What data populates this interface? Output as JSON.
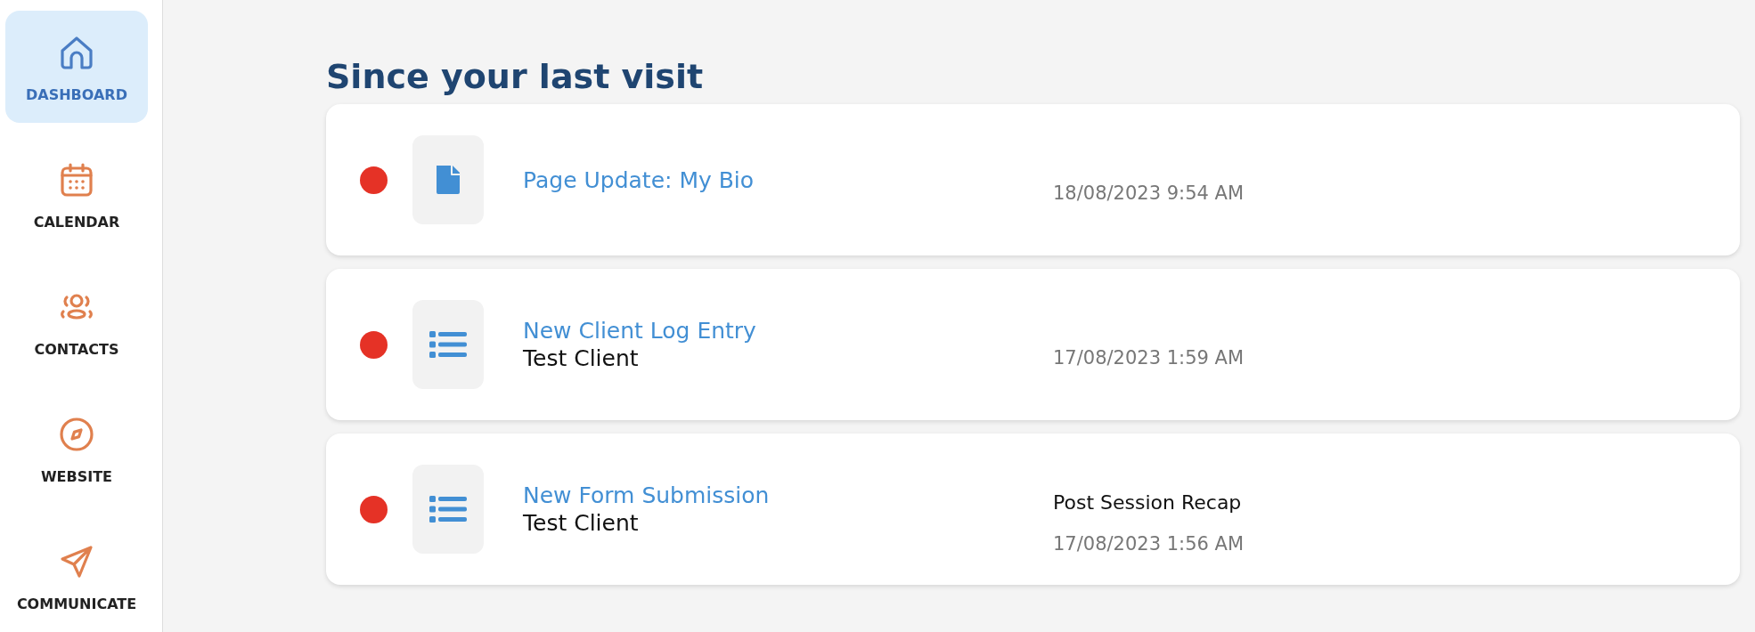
{
  "sidebar": {
    "items": [
      {
        "label": "DASHBOARD",
        "selected": true
      },
      {
        "label": "CALENDAR",
        "selected": false
      },
      {
        "label": "CONTACTS",
        "selected": false
      },
      {
        "label": "WEBSITE",
        "selected": false
      },
      {
        "label": "COMMUNICATE",
        "selected": false
      }
    ]
  },
  "main": {
    "title": "Since your last visit",
    "activities": [
      {
        "unread": true,
        "kind": "page",
        "title": "Page Update: My Bio",
        "date": "18/08/2023 9:54 AM"
      },
      {
        "unread": true,
        "kind": "entry",
        "title": "New Client Log Entry",
        "subtitle": "Test Client",
        "date": "17/08/2023 1:59 AM"
      },
      {
        "unread": true,
        "kind": "entry",
        "title": "New Form Submission",
        "subtitle": "Test Client",
        "detail": "Post Session Recap",
        "date": "17/08/2023 1:56 AM"
      }
    ]
  }
}
